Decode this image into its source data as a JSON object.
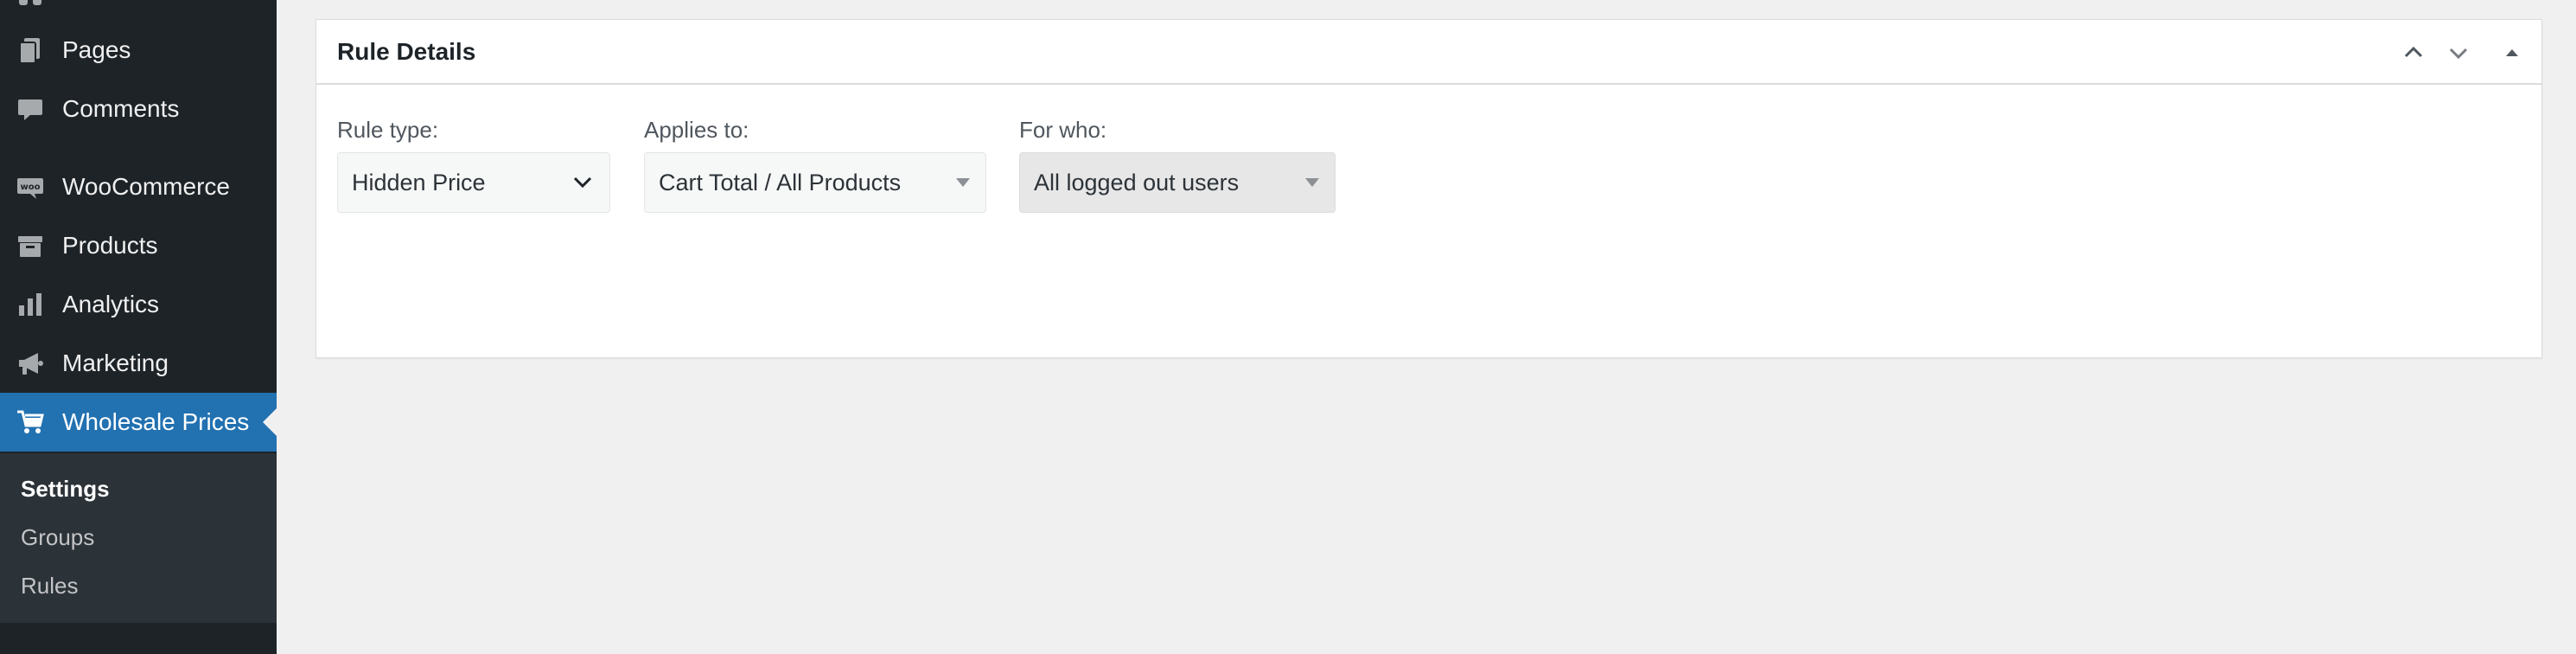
{
  "sidebar": {
    "items": [
      {
        "label": "Pages",
        "icon": "pages-icon"
      },
      {
        "label": "Comments",
        "icon": "comments-icon"
      },
      {
        "label": "WooCommerce",
        "icon": "woocommerce-icon"
      },
      {
        "label": "Products",
        "icon": "products-icon"
      },
      {
        "label": "Analytics",
        "icon": "analytics-icon"
      },
      {
        "label": "Marketing",
        "icon": "marketing-icon"
      },
      {
        "label": "Wholesale Prices",
        "icon": "cart-icon"
      }
    ],
    "submenu": [
      {
        "label": "Settings"
      },
      {
        "label": "Groups"
      },
      {
        "label": "Rules"
      }
    ]
  },
  "panel": {
    "title": "Rule Details",
    "fields": {
      "rule_type": {
        "label": "Rule type:",
        "value": "Hidden Price"
      },
      "applies_to": {
        "label": "Applies to:",
        "value": "Cart Total / All Products"
      },
      "for_who": {
        "label": "For who:",
        "value": "All logged out users"
      }
    }
  },
  "colors": {
    "sidebar_bg": "#1d2327",
    "submenu_bg": "#2c3338",
    "accent": "#2271b1",
    "page_bg": "#f0f0f1"
  }
}
